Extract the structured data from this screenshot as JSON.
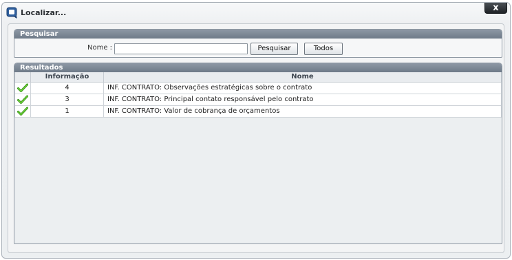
{
  "window": {
    "title": "Localizar...",
    "close_label": "x"
  },
  "search": {
    "header": "Pesquisar",
    "name_label": "Nome :",
    "name_value": "",
    "search_button": "Pesquisar",
    "all_button": "Todos"
  },
  "results": {
    "header": "Resultados",
    "columns": [
      "",
      "Informação",
      "Nome"
    ],
    "rows": [
      {
        "icon": "green-check-icon",
        "info": "4",
        "name": "INF. CONTRATO: Observações estratégicas sobre o contrato"
      },
      {
        "icon": "green-check-icon",
        "info": "3",
        "name": "INF. CONTRATO: Principal contato responsável pelo contrato"
      },
      {
        "icon": "green-check-icon",
        "info": "1",
        "name": "INF. CONTRATO: Valor de cobrança de orçamentos"
      }
    ]
  },
  "colors": {
    "panel_header": "#7b8694",
    "check_green": "#3aa815"
  }
}
